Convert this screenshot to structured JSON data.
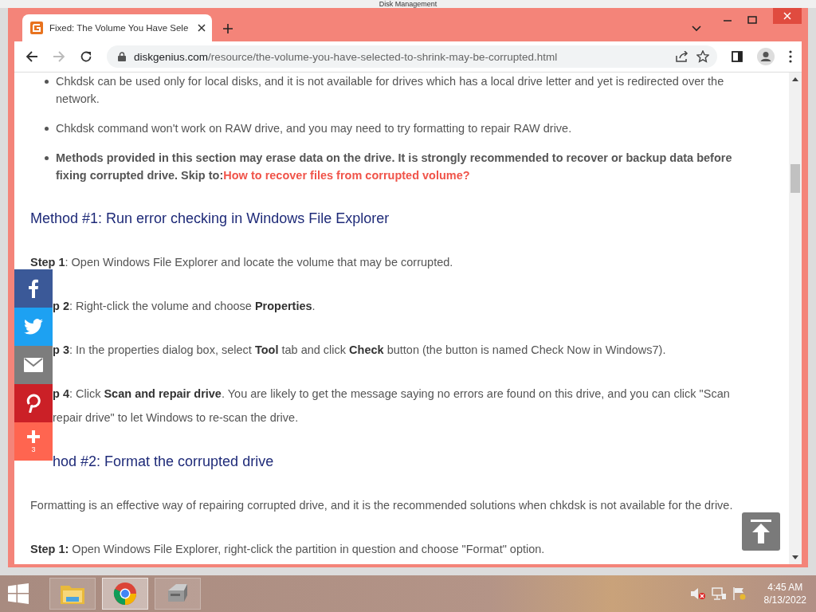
{
  "background_window": {
    "title": "Disk Management"
  },
  "browser": {
    "tabs": [
      {
        "title": "Fixed: The Volume You Have Sele",
        "selected": true
      }
    ],
    "address": {
      "domain": "diskgenius.com",
      "path": "/resource/the-volume-you-have-selected-to-shrink-may-be-corrupted.html"
    }
  },
  "article": {
    "bullets": [
      {
        "text": "Chkdsk can be used only for local disks, and it is not available for drives which has a local drive letter and yet is redirected over the network.",
        "emphasis": false
      },
      {
        "text": "Chkdsk command won't work on RAW drive, and you may need to try formatting to repair RAW drive.",
        "emphasis": false
      },
      {
        "text": "Methods provided in this section may erase data on the drive. It is strongly recommended to recover or backup data before fixing corrupted drive. Skip to:",
        "emphasis": true,
        "link": "How to recover files from corrupted volume?"
      }
    ],
    "blocks": [
      {
        "kind": "heading",
        "covered": false,
        "lines": [
          "Method #1: Run error checking in Windows File Explorer"
        ]
      },
      {
        "kind": "paragraph",
        "covered": false,
        "lines": [
          "**Step 1**: Open Windows File Explorer and locate the volume that may be corrupted."
        ]
      },
      {
        "kind": "paragraph",
        "covered": true,
        "lines": [
          "**p 2**: Right-click the volume and choose **Properties**."
        ]
      },
      {
        "kind": "paragraph",
        "covered": true,
        "lines": [
          "**p 3**: In the properties dialog box, select **Tool** tab and click **Check** button (the button is named Check Now in Windows7)."
        ]
      },
      {
        "kind": "paragraph",
        "covered": true,
        "lines": [
          "**p 4**: Click **Scan and repair drive**. You are likely to get the message saying no errors are found on this drive, and you can click \"Scan",
          "repair drive\" to let Windows to re-scan the drive."
        ]
      },
      {
        "kind": "heading",
        "covered": true,
        "lines": [
          "hod #2: Format the corrupted drive"
        ]
      },
      {
        "kind": "paragraph",
        "covered": false,
        "lines": [
          "Formatting is an effective way of repairing corrupted drive, and it is the recommended solutions when chkdsk is not available for the drive."
        ]
      },
      {
        "kind": "paragraph",
        "covered": false,
        "lines": [
          "**Step 1:** Open Windows File Explorer, right-click the partition in question and choose \"Format\" option."
        ]
      }
    ]
  },
  "share_bar": [
    {
      "kind": "facebook"
    },
    {
      "kind": "twitter"
    },
    {
      "kind": "email"
    },
    {
      "kind": "pinterest"
    },
    {
      "kind": "more",
      "count": "3"
    }
  ],
  "taskbar": {
    "apps": [
      {
        "kind": "folder",
        "selected": false
      },
      {
        "kind": "chrome",
        "selected": true
      },
      {
        "kind": "disk",
        "selected": false
      }
    ],
    "clock": {
      "time": "4:45 AM",
      "date": "8/13/2022"
    }
  }
}
